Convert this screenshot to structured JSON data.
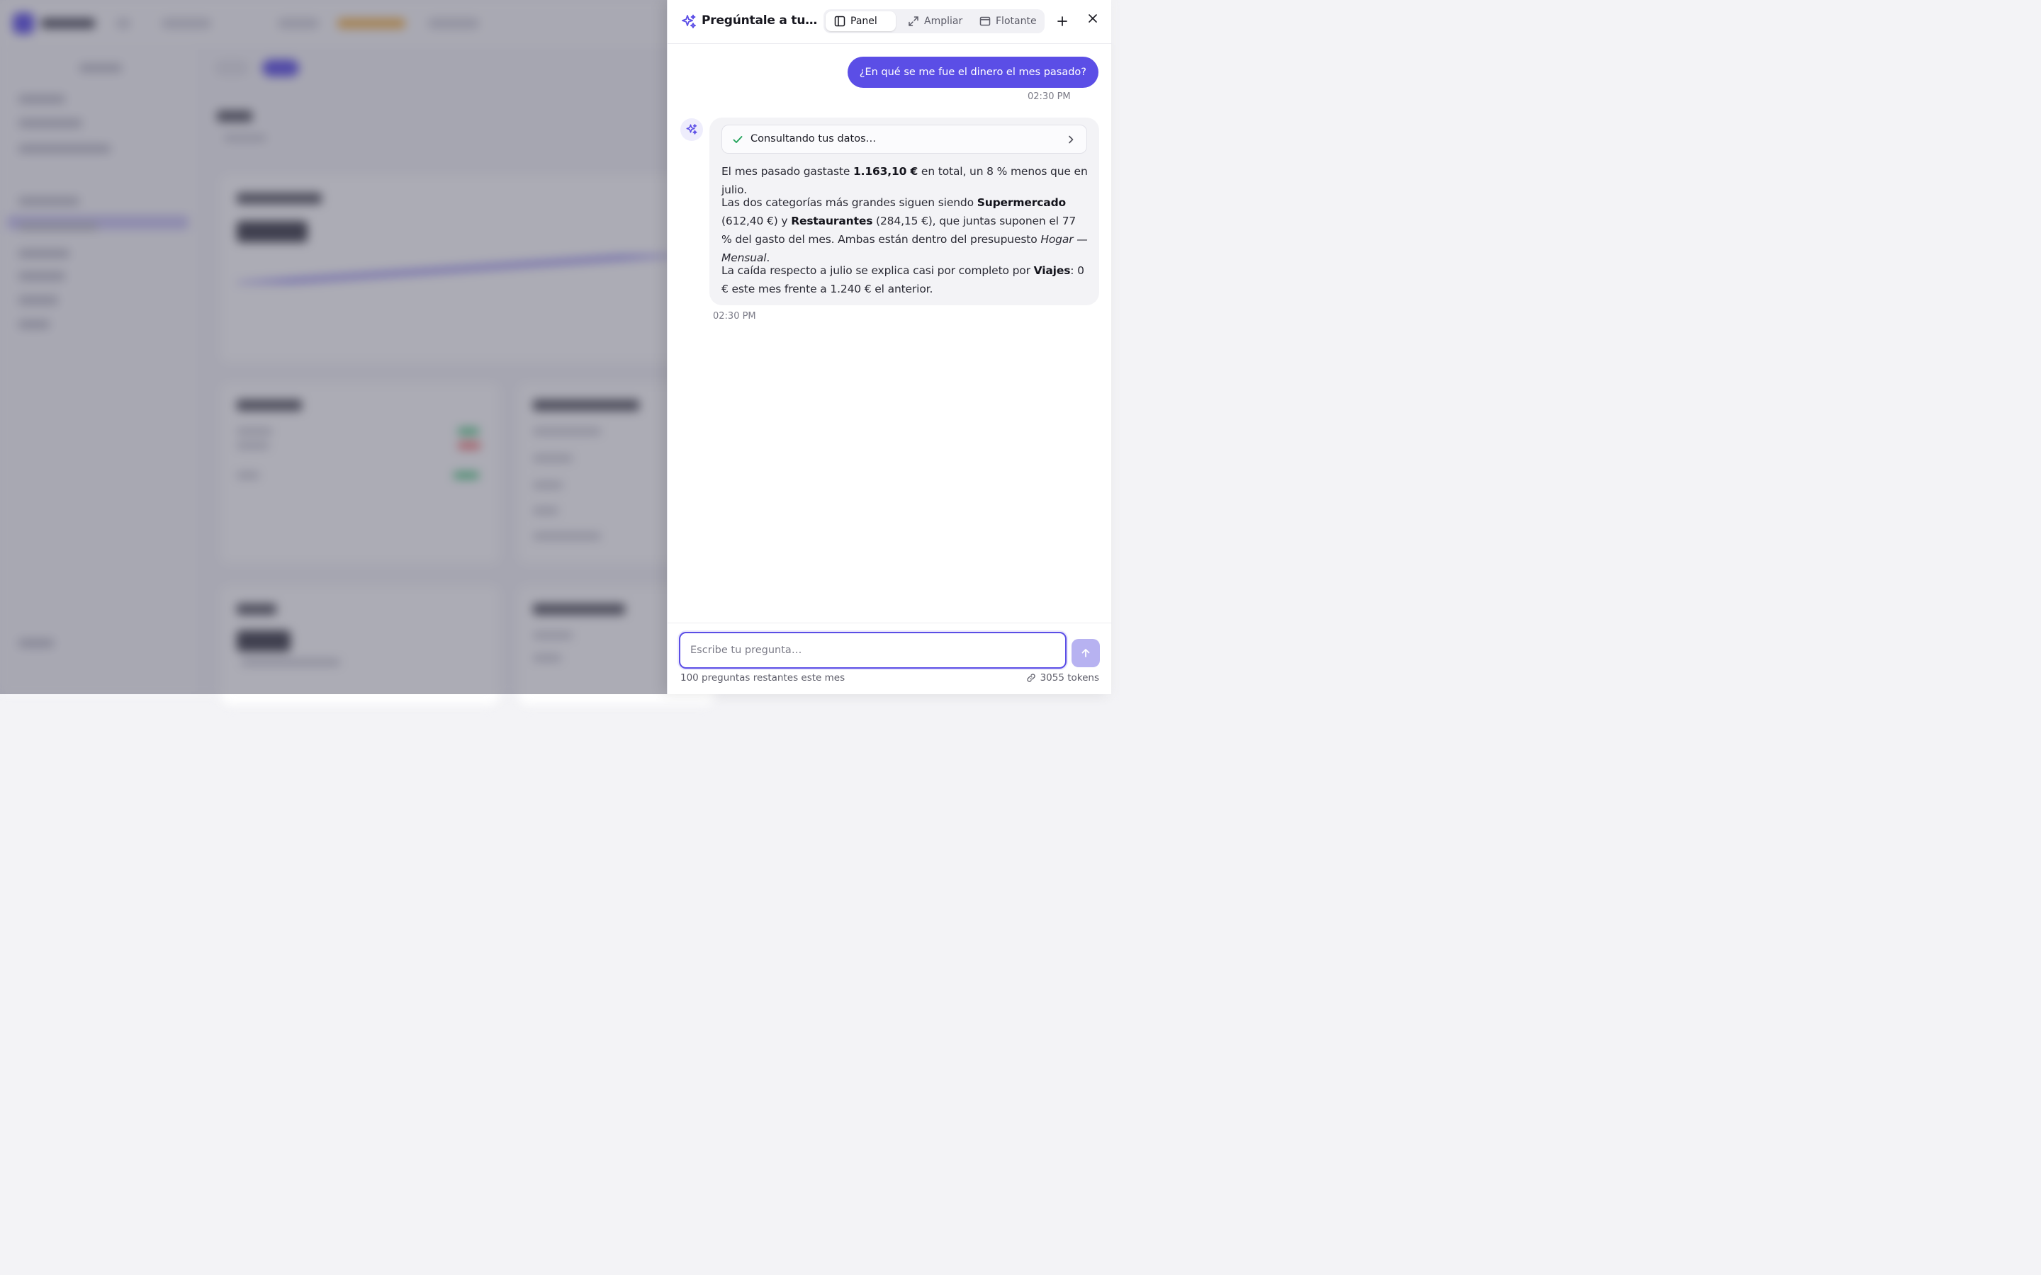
{
  "panel": {
    "title": "Pregúntale a tus finanzas",
    "modes": [
      {
        "label": "Panel",
        "active": true,
        "icon": "panel-icon"
      },
      {
        "label": "Ampliar",
        "active": false,
        "icon": "expand-icon"
      },
      {
        "label": "Flotante",
        "active": false,
        "icon": "floating-window-icon"
      }
    ],
    "actions": [
      "new-chat-icon",
      "close-icon"
    ]
  },
  "messages": {
    "user": {
      "text": "¿En qué se me fue el dinero el mes pasado?",
      "time": "02:30 PM"
    },
    "assistant": {
      "tool": {
        "label": "Consultando tus datos…",
        "status": "done"
      },
      "p1": {
        "a": "El mes pasado gastaste ",
        "b": "1.163,10 €",
        "c": " en total, un 8 % menos que en julio."
      },
      "p2": {
        "a": "Las dos categorías más grandes siguen siendo ",
        "b": "Supermercado",
        "c": " (612,40 €) y ",
        "d": "Restaurantes",
        "e": " (284,15 €), que juntas suponen el 77 % del gasto del mes. Ambas están dentro del presupuesto ",
        "f": "Hogar — Mensual",
        "g": "."
      },
      "p3": {
        "a": "La caída respecto a julio se explica casi por completo por ",
        "b": "Viajes",
        "c": ": 0 € este mes frente a 1.240 € el anterior."
      },
      "time": "02:30 PM"
    }
  },
  "composer": {
    "placeholder": "Escribe tu pregunta…",
    "remaining": "100 preguntas restantes este mes",
    "tokens": "3055 tokens"
  },
  "colors": {
    "accent": "#5b4ee6",
    "accent_light": "#b7b2f1",
    "success": "#22a35a"
  }
}
